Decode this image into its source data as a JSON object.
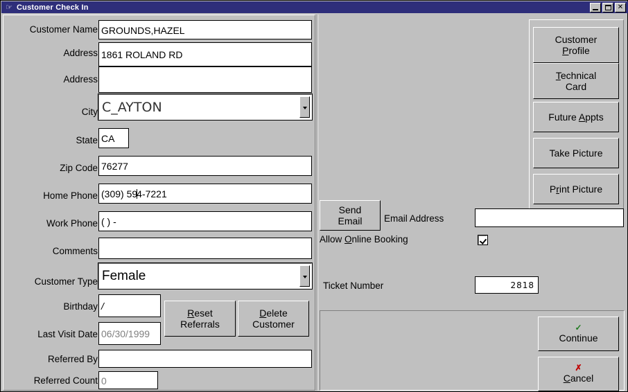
{
  "window": {
    "title": "Customer Check In",
    "icon": "app-icon",
    "titlebar_color": "#2e2e7a",
    "face_color": "#c0c0c0",
    "buttons": {
      "minimize": "_",
      "maximize": "□",
      "close": "✕"
    }
  },
  "form": {
    "fields": [
      {
        "label": "Customer Name",
        "value": "GROUNDS,HAZEL"
      },
      {
        "label": "Address",
        "value": "1861 ROLAND RD"
      },
      {
        "label": "Address",
        "value": ""
      },
      {
        "label": "City",
        "value": "C_AYTON"
      },
      {
        "label": "State",
        "value": "CA"
      },
      {
        "label": "Zip Code",
        "value": "76277"
      },
      {
        "label": "Home Phone",
        "value_before": "(309) 59",
        "value_after": "4-7221"
      },
      {
        "label": "Work Phone",
        "value": "(   )    -"
      },
      {
        "label": "Comments",
        "value": ""
      },
      {
        "label": "Customer Type",
        "value": "Female"
      },
      {
        "label": "Birthday",
        "value": "  /"
      },
      {
        "label": "Last Visit Date",
        "value": "06/30/1999"
      },
      {
        "label": "Referred By",
        "value": ""
      },
      {
        "label": "Referred Count",
        "value": "0"
      }
    ]
  },
  "form_buttons": {
    "reset_referrals": {
      "line1_pre": "",
      "line1_accel": "R",
      "line1_post": "eset",
      "line2": "Referrals"
    },
    "delete_customer": {
      "line1_pre": "",
      "line1_accel": "D",
      "line1_post": "elete",
      "line2": "Customer"
    }
  },
  "side_buttons": [
    {
      "name": "customer-profile",
      "line1": "Customer",
      "line2_pre": "",
      "line2_accel": "P",
      "line2_post": "rofile"
    },
    {
      "name": "technical-card",
      "line1_pre": "",
      "line1_accel": "T",
      "line1_post": "echnical",
      "line2": "Card"
    },
    {
      "name": "future-appts",
      "line1_pre": "Future ",
      "line1_accel": "A",
      "line1_post": "ppts"
    },
    {
      "name": "take-picture",
      "line1_pre": "Take Picture",
      "line1_accel": "",
      "line1_post": ""
    },
    {
      "name": "print-picture",
      "line1_pre": "P",
      "line1_accel": "r",
      "line1_post": "int Picture"
    }
  ],
  "email": {
    "send_button_line1": "Send",
    "send_button_line2": "Email",
    "address_label": "Email Address",
    "address_value": "",
    "online_booking_pre": "Allow ",
    "online_booking_accel": "O",
    "online_booking_post": "nline Booking",
    "online_booking_checked": true
  },
  "ticket": {
    "label": "Ticket Number",
    "value": "2818"
  },
  "actions": {
    "continue": {
      "icon": "check-icon",
      "glyph": "✓",
      "label": "Continue",
      "color": "#1f7a1f"
    },
    "cancel": {
      "icon": "x-icon",
      "glyph": "✗",
      "label_accel": "C",
      "label_rest": "ancel",
      "color": "#c00000"
    }
  }
}
